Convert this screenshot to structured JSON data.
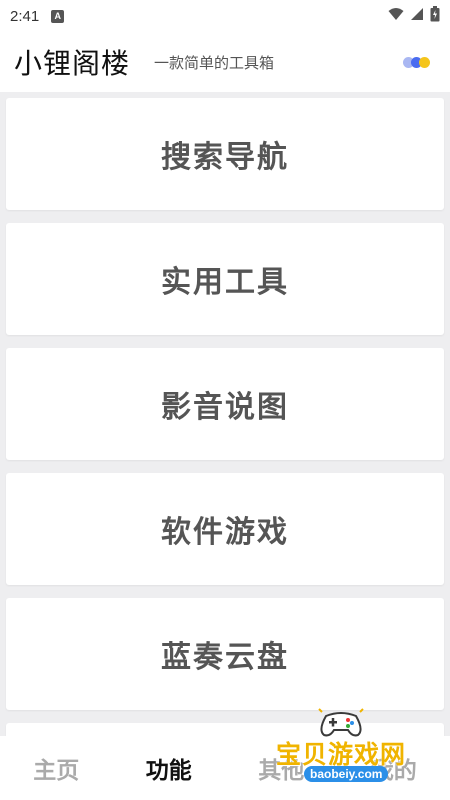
{
  "status_bar": {
    "time": "2:41",
    "badge_letter": "A",
    "icons": [
      "wifi-icon",
      "signal-icon",
      "battery-icon"
    ]
  },
  "header": {
    "title": "小锂阁楼",
    "subtitle": "一款简单的工具箱",
    "menu_icon": "colored-dots-icon",
    "dot_colors": [
      "#a9b7f2",
      "#4a6cf0",
      "#f5c51b"
    ]
  },
  "cards": [
    {
      "label": "搜索导航"
    },
    {
      "label": "实用工具"
    },
    {
      "label": "影音说图"
    },
    {
      "label": "软件游戏"
    },
    {
      "label": "蓝奏云盘"
    }
  ],
  "bottom_nav": {
    "tabs": [
      {
        "label": "主页",
        "active": false
      },
      {
        "label": "功能",
        "active": true
      },
      {
        "label": "其他",
        "active": false
      },
      {
        "label": "我的",
        "active": false
      }
    ]
  },
  "watermark": {
    "text": "宝贝游戏网",
    "url": "baobeiy.com"
  }
}
